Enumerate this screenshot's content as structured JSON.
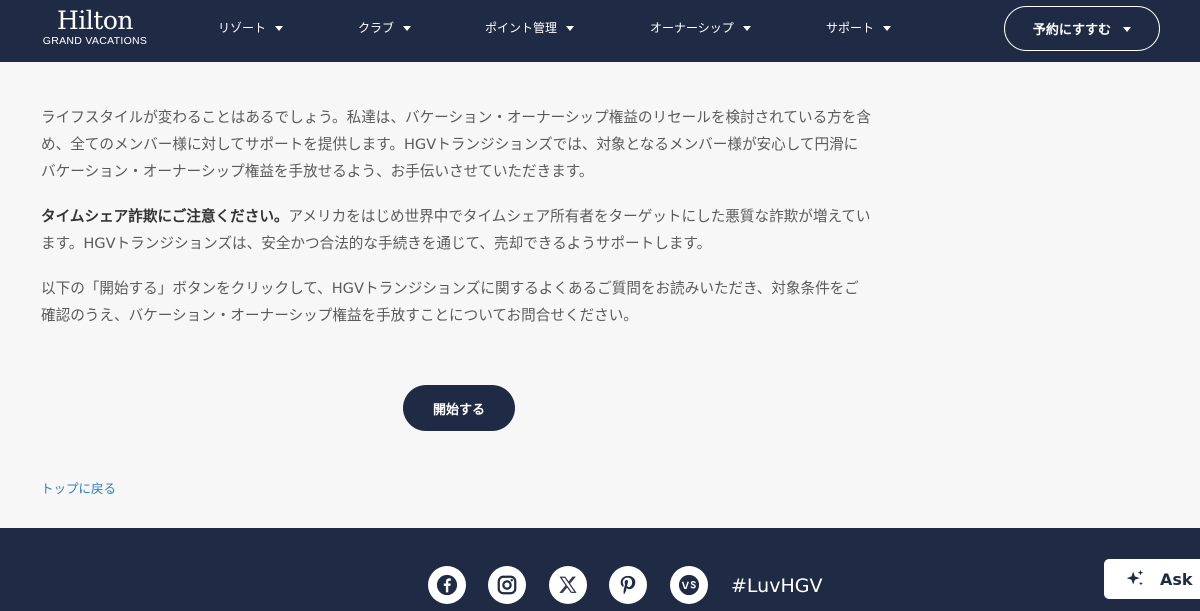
{
  "header": {
    "logo_main": "Hilton",
    "logo_sub": "GRAND VACATIONS",
    "nav": [
      {
        "label": "リゾート"
      },
      {
        "label": "クラブ"
      },
      {
        "label": "ポイント管理"
      },
      {
        "label": "オーナーシップ"
      },
      {
        "label": "サポート"
      }
    ],
    "reserve_label": "予約にすすむ"
  },
  "main": {
    "para1": "ライフスタイルが変わることはあるでしょう。私達は、バケーション・オーナーシップ権益のリセールを検討されている方を含め、全てのメンバー様に対してサポートを提供します。HGVトランジションズでは、対象となるメンバー様が安心して円滑にバケーション・オーナーシップ権益を手放せるよう、お手伝いさせていただきます。",
    "para2_strong": "タイムシェア詐欺にご注意ください。",
    "para2_rest": "アメリカをはじめ世界中でタイムシェア所有者をターゲットにした悪質な詐欺が増えています。HGVトランジションズは、安全かつ合法的な手続きを通じて、売却できるようサポートします。",
    "para3": "以下の「開始する」ボタンをクリックして、HGVトランジションズに関するよくあるご質問をお読みいただき、対象条件をご確認のうえ、バケーション・オーナーシップ権益を手放すことについてお問合せください。",
    "start_label": "開始する",
    "back_to_top": "トップに戻る"
  },
  "footer": {
    "social_icons": [
      "facebook-icon",
      "instagram-icon",
      "x-icon",
      "pinterest-icon",
      "vs-icon"
    ],
    "hashtag": "#LuvHGV"
  },
  "chat_widget": {
    "label": "Ask"
  },
  "colors": {
    "navy": "#1f2a44",
    "background": "#f7f7f7",
    "link": "#2e7fc2",
    "body_text": "#5b5b5b"
  }
}
